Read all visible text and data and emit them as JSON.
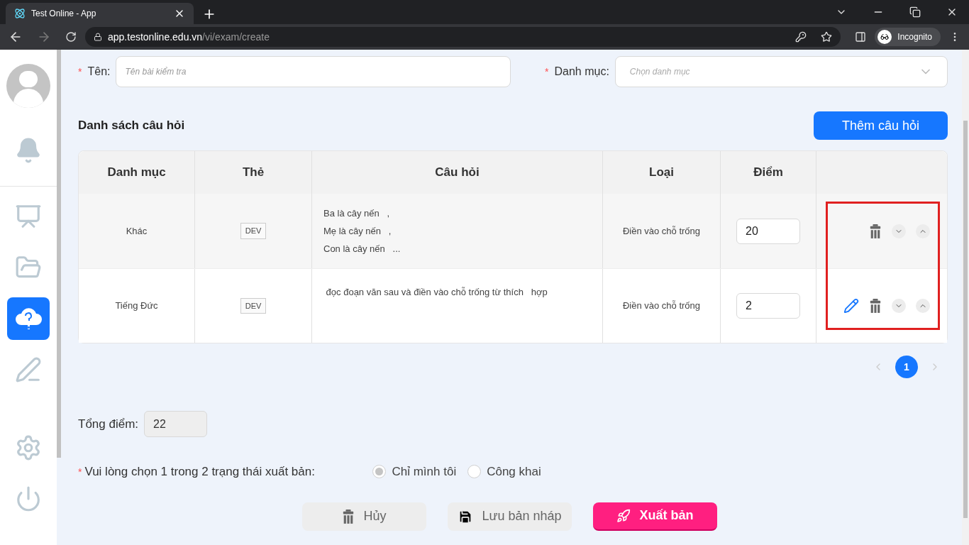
{
  "browser": {
    "tab_title": "Test Online - App",
    "url_host": "app.testonline.edu.vn",
    "url_path": "/vi/exam/create",
    "profile": "Incognito"
  },
  "sidebar": {
    "items": [
      {
        "kind": "bell",
        "selected": false
      },
      {
        "kind": "teacher",
        "selected": false
      },
      {
        "kind": "folder",
        "selected": false
      },
      {
        "kind": "cloud-question",
        "selected": true
      },
      {
        "kind": "writing",
        "selected": false
      },
      {
        "kind": "gear",
        "selected": false
      },
      {
        "kind": "power",
        "selected": false
      }
    ]
  },
  "form": {
    "name": {
      "label": "Tên:",
      "required_mark": "*",
      "placeholder": "Tên bài kiểm tra"
    },
    "category": {
      "label": "Danh mục:",
      "required_mark": "*",
      "placeholder": "Chọn danh mục"
    }
  },
  "questions": {
    "title": "Danh sách câu hỏi",
    "add_button": "Thêm câu hỏi",
    "columns": [
      "Danh mục",
      "Thẻ",
      "Câu hỏi",
      "Loại",
      "Điểm"
    ],
    "rows": [
      {
        "category": "Khác",
        "tag": "DEV",
        "question": [
          "Ba là cây nến   ,",
          "Mẹ là cây nến   ,",
          "Con là cây nến   ..."
        ],
        "type": "Điền vào chỗ trống",
        "score": "20",
        "editable": false
      },
      {
        "category": "Tiếng Đức",
        "tag": "DEV",
        "question": [
          " đọc đoạn văn sau và điền vào chỗ trống từ thích   hợp"
        ],
        "type": "Điền vào chỗ trống",
        "score": "2",
        "editable": true
      }
    ],
    "pagination": [
      {
        "label": "1",
        "selected": true
      }
    ]
  },
  "total": {
    "label": "Tổng điểm:",
    "value": "22"
  },
  "publish": {
    "label": "Vui lòng chọn 1 trong 2 trạng thái xuất bản:",
    "required_mark": "*",
    "options": [
      {
        "label": "Chỉ mình tôi",
        "selected": true
      },
      {
        "label": "Công khai",
        "selected": false
      }
    ]
  },
  "buttons": [
    {
      "kind": "cancel",
      "label": "Hủy"
    },
    {
      "kind": "draft",
      "label": "Lưu bản nháp"
    },
    {
      "kind": "publish",
      "label": "Xuất bản"
    }
  ]
}
